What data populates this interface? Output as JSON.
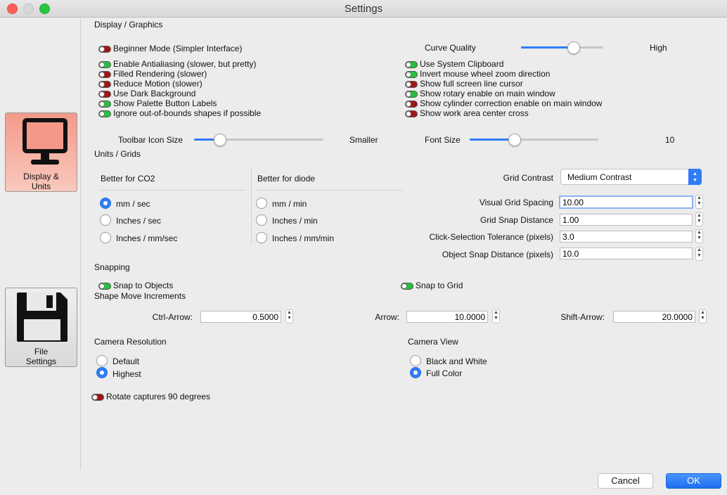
{
  "window": {
    "title": "Settings"
  },
  "sidebar": {
    "display_units": {
      "label_line1": "Display &",
      "label_line2": "Units",
      "icon": "monitor-icon"
    },
    "file_settings": {
      "label_line1": "File",
      "label_line2": "Settings",
      "icon": "floppy-disk-icon"
    }
  },
  "display_graphics": {
    "heading": "Display / Graphics",
    "beginner_mode": {
      "label": "Beginner Mode (Simpler Interface)",
      "on": false
    },
    "left_toggles": [
      {
        "label": "Enable Antialiasing (slower, but pretty)",
        "on": true
      },
      {
        "label": "Filled Rendering (slower)",
        "on": false
      },
      {
        "label": "Reduce Motion (slower)",
        "on": false
      },
      {
        "label": "Use Dark Background",
        "on": false
      },
      {
        "label": "Show Palette Button Labels",
        "on": true
      },
      {
        "label": "Ignore out-of-bounds shapes if possible",
        "on": true
      }
    ],
    "right_toggles": [
      {
        "label": "Use System Clipboard",
        "on": true
      },
      {
        "label": "Invert mouse wheel zoom direction",
        "on": true
      },
      {
        "label": "Show full screen line cursor",
        "on": false
      },
      {
        "label": "Show rotary enable on main window",
        "on": true
      },
      {
        "label": "Show cylinder correction enable on main window",
        "on": false
      },
      {
        "label": "Show work area center cross",
        "on": false
      }
    ],
    "curve_quality": {
      "label": "Curve Quality",
      "value_text": "High",
      "level": 0.64
    },
    "toolbar_icon_size": {
      "label": "Toolbar Icon Size",
      "value_text": "Smaller",
      "level": 0.2
    },
    "font_size": {
      "label": "Font Size",
      "value_text": "10",
      "level": 0.35
    }
  },
  "units_grids": {
    "heading": "Units / Grids",
    "co2": {
      "heading": "Better for CO2",
      "options": [
        "mm / sec",
        "Inches / sec",
        "Inches / mm/sec"
      ],
      "selected": 0
    },
    "diode": {
      "heading": "Better for diode",
      "options": [
        "mm / min",
        "Inches / min",
        "Inches / mm/min"
      ],
      "selected": -1
    },
    "grid_contrast": {
      "label": "Grid Contrast",
      "value": "Medium Contrast"
    },
    "visual_grid_spacing": {
      "label": "Visual Grid Spacing",
      "value": "10.00"
    },
    "grid_snap_distance": {
      "label": "Grid Snap Distance",
      "value": "1.00"
    },
    "click_selection_tolerance": {
      "label": "Click-Selection Tolerance (pixels)",
      "value": "3.0"
    },
    "object_snap_distance": {
      "label": "Object Snap Distance (pixels)",
      "value": "10.0"
    }
  },
  "snapping": {
    "heading": "Snapping",
    "snap_to_objects": {
      "label": "Snap to Objects",
      "on": true
    },
    "snap_to_grid": {
      "label": "Snap to Grid",
      "on": true
    }
  },
  "shape_move": {
    "heading": "Shape Move Increments",
    "ctrl_arrow": {
      "label": "Ctrl-Arrow:",
      "value": "0.5000"
    },
    "arrow": {
      "label": "Arrow:",
      "value": "10.0000"
    },
    "shift_arrow": {
      "label": "Shift-Arrow:",
      "value": "20.0000"
    }
  },
  "camera_resolution": {
    "heading": "Camera Resolution",
    "options": [
      "Default",
      "Highest"
    ],
    "selected": 1
  },
  "camera_view": {
    "heading": "Camera View",
    "options": [
      "Black and White",
      "Full Color"
    ],
    "selected": 1
  },
  "rotate_captures": {
    "label": "Rotate captures 90 degrees",
    "on": false
  },
  "footer": {
    "cancel_label": "Cancel",
    "ok_label": "OK"
  },
  "colors": {
    "accent": "#2f7cf6",
    "toggle_on": "#22c33a",
    "toggle_off": "#a31515",
    "sidebar_active": "#f08a76"
  }
}
